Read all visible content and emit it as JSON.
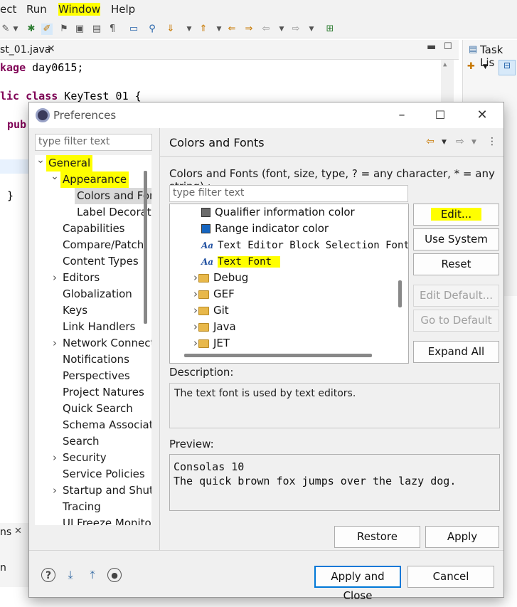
{
  "menubar": [
    "ect",
    "Run",
    "Window",
    "Help"
  ],
  "editor": {
    "tab_label": "st_01.java",
    "lines": [
      {
        "kw": "kage",
        "text": " day0615;"
      },
      {
        "kw": "lic class",
        "text": " KeyTest 01 {"
      },
      {
        "kw": "pub",
        "text": ""
      },
      {
        "kw": "",
        "text": "}"
      }
    ]
  },
  "task_list": {
    "label": "Task Lis"
  },
  "bottom_panel": {
    "tab": "ns",
    "text": "n"
  },
  "dialog": {
    "title": "Preferences",
    "filter_placeholder": "type filter text",
    "tree": [
      {
        "label": "General",
        "level": 0,
        "twisty": "down",
        "highlight": true
      },
      {
        "label": "Appearance",
        "level": 1,
        "twisty": "down",
        "highlight": true
      },
      {
        "label": "Colors and Fonts",
        "level": 2,
        "twisty": "",
        "selected": true
      },
      {
        "label": "Label Decorations",
        "level": 2,
        "twisty": ""
      },
      {
        "label": "Capabilities",
        "level": 1,
        "twisty": ""
      },
      {
        "label": "Compare/Patch",
        "level": 1,
        "twisty": ""
      },
      {
        "label": "Content Types",
        "level": 1,
        "twisty": ""
      },
      {
        "label": "Editors",
        "level": 1,
        "twisty": "right"
      },
      {
        "label": "Globalization",
        "level": 1,
        "twisty": ""
      },
      {
        "label": "Keys",
        "level": 1,
        "twisty": ""
      },
      {
        "label": "Link Handlers",
        "level": 1,
        "twisty": ""
      },
      {
        "label": "Network Connections",
        "level": 1,
        "twisty": "right"
      },
      {
        "label": "Notifications",
        "level": 1,
        "twisty": ""
      },
      {
        "label": "Perspectives",
        "level": 1,
        "twisty": ""
      },
      {
        "label": "Project Natures",
        "level": 1,
        "twisty": ""
      },
      {
        "label": "Quick Search",
        "level": 1,
        "twisty": ""
      },
      {
        "label": "Schema Associations",
        "level": 1,
        "twisty": ""
      },
      {
        "label": "Search",
        "level": 1,
        "twisty": ""
      },
      {
        "label": "Security",
        "level": 1,
        "twisty": "right"
      },
      {
        "label": "Service Policies",
        "level": 1,
        "twisty": ""
      },
      {
        "label": "Startup and Shutdown",
        "level": 1,
        "twisty": "right"
      },
      {
        "label": "Tracing",
        "level": 1,
        "twisty": ""
      },
      {
        "label": "UI Freeze Monitoring",
        "level": 1,
        "twisty": ""
      }
    ],
    "page": {
      "title": "Colors and Fonts",
      "intro": "Colors and Fonts (font, size, type, ? = any character, * = any string) :",
      "filter_placeholder": "type filter text",
      "items": [
        {
          "label": "Qualifier information color",
          "kind": "swatch",
          "color": "#6b6b6b"
        },
        {
          "label": "Range indicator color",
          "kind": "swatch",
          "color": "#1565c0"
        },
        {
          "label": "Text Editor Block Selection Font",
          "kind": "font"
        },
        {
          "label": "Text Font",
          "kind": "font",
          "highlight": true
        },
        {
          "label": "Debug",
          "kind": "folder"
        },
        {
          "label": "GEF",
          "kind": "folder"
        },
        {
          "label": "Git",
          "kind": "folder"
        },
        {
          "label": "Java",
          "kind": "folder"
        },
        {
          "label": "JET",
          "kind": "folder"
        }
      ],
      "buttons": {
        "edit": "Edit...",
        "use_system_font": "Use System Font",
        "reset": "Reset",
        "edit_default": "Edit Default...",
        "go_to_default": "Go to Default",
        "expand_all": "Expand All"
      },
      "description_label": "Description:",
      "description": "The text font is used by text editors.",
      "preview_label": "Preview:",
      "preview_lines": [
        "Consolas 10",
        "The quick brown fox jumps over the lazy dog."
      ],
      "restore_defaults": "Restore Defaults",
      "apply": "Apply"
    },
    "footer": {
      "apply_and_close": "Apply and Close",
      "cancel": "Cancel"
    }
  },
  "colors": {
    "highlight": "#ffff00",
    "accent": "#0078d7"
  }
}
